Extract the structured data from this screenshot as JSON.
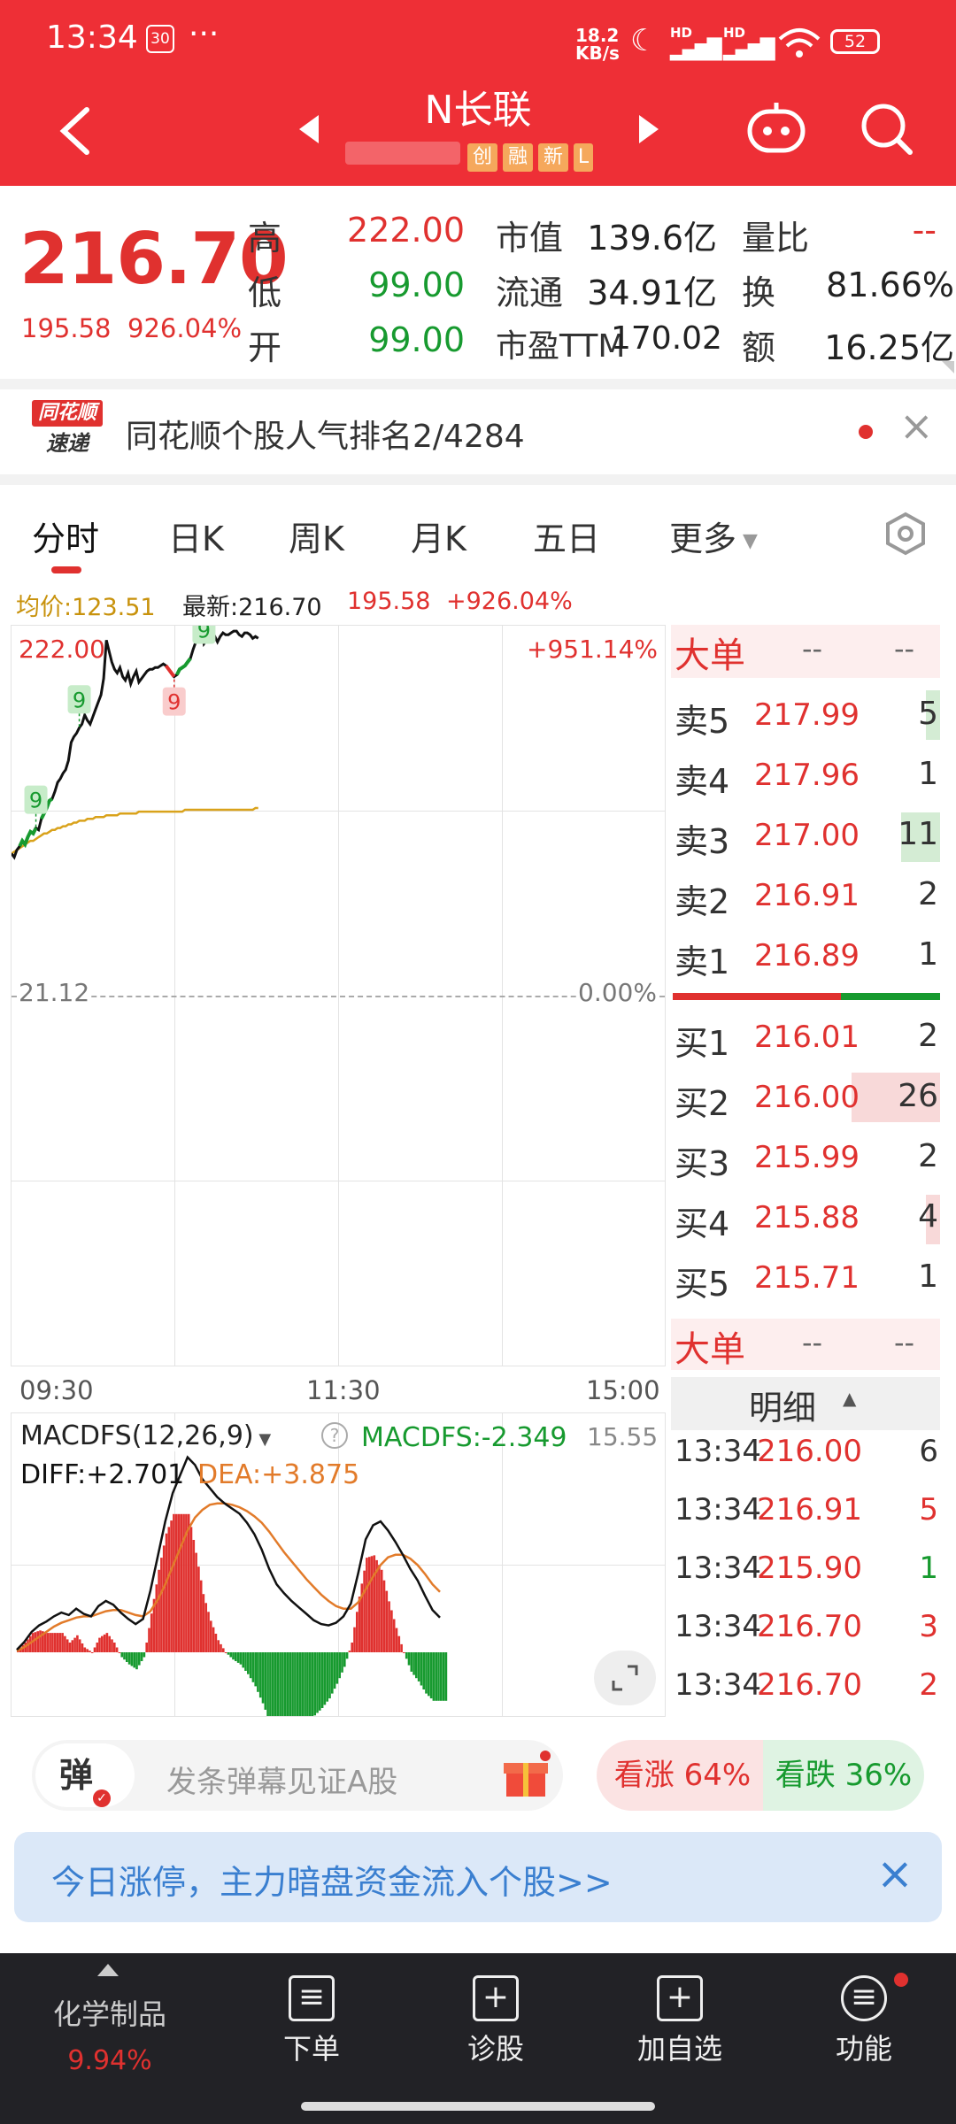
{
  "status_bar": {
    "time": "13:34",
    "badge": "30",
    "dots": "···",
    "net_speed_value": "18.2",
    "net_speed_unit": "KB/s",
    "signal1": "HD",
    "signal2": "HD",
    "battery": "52"
  },
  "header": {
    "stock_name": "N长联",
    "tags": [
      "创",
      "融",
      "新",
      "L"
    ]
  },
  "quote": {
    "price": "216.70",
    "change": "195.58",
    "change_pct": "926.04%",
    "high_label": "高",
    "high": "222.00",
    "low_label": "低",
    "low": "99.00",
    "open_label": "开",
    "open": "99.00",
    "mcap_label": "市值",
    "mcap": "139.6亿",
    "float_label": "流通",
    "float": "34.91亿",
    "pe_label": "市盈TTM",
    "pe": "170.02",
    "vol_ratio_label": "量比",
    "vol_ratio": "--",
    "turnover_label": "换",
    "turnover": "81.66%",
    "amount_label": "额",
    "amount": "16.25亿"
  },
  "news": {
    "logo_top": "同花顺",
    "logo_bottom": "速递",
    "text": "同花顺个股人气排名2/4284",
    "close": "×"
  },
  "tabs": {
    "items": [
      "分时",
      "日K",
      "周K",
      "月K",
      "五日",
      "更多"
    ],
    "active_index": 0
  },
  "chart_info": {
    "avg_label": "均价:123.51",
    "latest_label": "最新:216.70",
    "change": "195.58",
    "change_pct": "+926.04%"
  },
  "chart_data": {
    "type": "line",
    "title": "",
    "y_top": "222.00",
    "y_top_pct": "+951.14%",
    "y_mid": "21.12",
    "y_mid_pct": "0.00%",
    "x_ticks": [
      "09:30",
      "11:30",
      "15:00"
    ],
    "signals": [
      "9",
      "9",
      "9",
      "9"
    ],
    "series": [
      {
        "name": "价格",
        "values": [
          99,
          97,
          101,
          103,
          106,
          104,
          108,
          111,
          110,
          113,
          112,
          118,
          121,
          124,
          128,
          129,
          133,
          138,
          140,
          143,
          145,
          150,
          160,
          163,
          165,
          168,
          170,
          175,
          172,
          170,
          174,
          178,
          182,
          186,
          195,
          216,
          210,
          204,
          200,
          198,
          201,
          196,
          194,
          198,
          192,
          196,
          199,
          193,
          195,
          197,
          199,
          200,
          200,
          201,
          201,
          202,
          203,
          202,
          200,
          198,
          196,
          197,
          200,
          201,
          202,
          204,
          206,
          211,
          215,
          218,
          222,
          214,
          216,
          219,
          221,
          218,
          215,
          218,
          220,
          219,
          219,
          220,
          221,
          221,
          219,
          218,
          220,
          220,
          219,
          217,
          218,
          217
        ]
      },
      {
        "name": "均价",
        "values": [
          99,
          100,
          101,
          102,
          103,
          104,
          105,
          106,
          106,
          107,
          108,
          109,
          110,
          110,
          111,
          112,
          112,
          113,
          113,
          114,
          114,
          115,
          115,
          116,
          116,
          117,
          117,
          117,
          118,
          118,
          118,
          119,
          119,
          119,
          119,
          120,
          120,
          120,
          120,
          120,
          121,
          121,
          121,
          121,
          121,
          121,
          121,
          122,
          122,
          122,
          122,
          122,
          122,
          122,
          122,
          122,
          122,
          122,
          122,
          122,
          122,
          122,
          122,
          122,
          123,
          123,
          123,
          123,
          123,
          123,
          123,
          123,
          123,
          123,
          123,
          123,
          123,
          123,
          123,
          123,
          123,
          123,
          123,
          123,
          123,
          123,
          123,
          123,
          123,
          123,
          124,
          124
        ]
      }
    ]
  },
  "macd": {
    "title": "MACDFS(12,26,9)",
    "value_label": "MACDFS:-2.349",
    "top_value": "15.55",
    "diff_label": "DIFF:+2.701",
    "dea_label": "DEA:+3.875",
    "diff": [
      0.2,
      0.8,
      1.6,
      2.1,
      2.4,
      2.8,
      3.1,
      2.9,
      3.4,
      3.0,
      2.8,
      3.6,
      4.0,
      3.7,
      3.1,
      2.6,
      2.2,
      2.6,
      4.8,
      7.5,
      10.2,
      12.4,
      13.8,
      15.2,
      14.6,
      13.5,
      12.8,
      12.1,
      11.6,
      11.2,
      10.8,
      10.1,
      9.2,
      8.0,
      6.5,
      5.3,
      4.6,
      4.0,
      3.5,
      3.0,
      2.5,
      2.2,
      2.1,
      2.3,
      2.8,
      3.8,
      6.2,
      8.8,
      9.9,
      10.2,
      9.5,
      8.6,
      7.6,
      6.5,
      5.6,
      4.4,
      3.3,
      2.7
    ],
    "dea": [
      0.1,
      0.4,
      0.8,
      1.2,
      1.6,
      2.0,
      2.3,
      2.5,
      2.7,
      2.8,
      2.8,
      3.0,
      3.2,
      3.3,
      3.3,
      3.1,
      2.9,
      2.8,
      3.2,
      4.1,
      5.3,
      6.7,
      8.1,
      9.5,
      10.5,
      11.1,
      11.5,
      11.6,
      11.6,
      11.5,
      11.3,
      11.0,
      10.6,
      10.1,
      9.4,
      8.6,
      7.8,
      7.1,
      6.4,
      5.7,
      5.1,
      4.5,
      4.0,
      3.6,
      3.4,
      3.4,
      3.9,
      4.9,
      5.9,
      6.8,
      7.4,
      7.6,
      7.6,
      7.3,
      6.8,
      6.1,
      5.3,
      4.7
    ]
  },
  "orderbook": {
    "header_label": "大单",
    "header_v1": "--",
    "header_v2": "--",
    "asks": [
      {
        "label": "卖5",
        "price": "217.99",
        "vol": "5"
      },
      {
        "label": "卖4",
        "price": "217.96",
        "vol": "1"
      },
      {
        "label": "卖3",
        "price": "217.00",
        "vol": "11"
      },
      {
        "label": "卖2",
        "price": "216.91",
        "vol": "2"
      },
      {
        "label": "卖1",
        "price": "216.89",
        "vol": "1"
      }
    ],
    "bids": [
      {
        "label": "买1",
        "price": "216.01",
        "vol": "2"
      },
      {
        "label": "买2",
        "price": "216.00",
        "vol": "26"
      },
      {
        "label": "买3",
        "price": "215.99",
        "vol": "2"
      },
      {
        "label": "买4",
        "price": "215.88",
        "vol": "4"
      },
      {
        "label": "买5",
        "price": "215.71",
        "vol": "1"
      }
    ],
    "footer_label": "大单",
    "footer_v1": "--",
    "footer_v2": "--",
    "detail_label": "明细"
  },
  "ticks": [
    {
      "time": "13:34",
      "price": "216.00",
      "vol": "6",
      "dir": "sell"
    },
    {
      "time": "13:34",
      "price": "216.91",
      "vol": "5",
      "dir": "buy"
    },
    {
      "time": "13:34",
      "price": "215.90",
      "vol": "1",
      "dir": "sell"
    },
    {
      "time": "13:34",
      "price": "216.70",
      "vol": "3",
      "dir": "buy"
    },
    {
      "time": "13:34",
      "price": "216.70",
      "vol": "2",
      "dir": "buy"
    }
  ],
  "barrage": {
    "icon_label": "弹",
    "placeholder": "发条弹幕见证A股",
    "bull": "看涨 64%",
    "bear": "看跌 36%"
  },
  "banner": {
    "text": "今日涨停，主力暗盘资金流入个股>>",
    "close": "×"
  },
  "bottom_nav": {
    "sector_name": "化学制品",
    "sector_pct": "9.94%",
    "items": [
      {
        "label": "下单",
        "icon": "order-icon"
      },
      {
        "label": "诊股",
        "icon": "diagnose-icon"
      },
      {
        "label": "加自选",
        "icon": "add-watchlist-icon"
      },
      {
        "label": "功能",
        "icon": "menu-icon"
      }
    ]
  },
  "colors": {
    "header": "#ee2f36",
    "up": "#e0312f",
    "down": "#179a2f",
    "avg": "#d9a21b",
    "macd_dea": "#e27b2a"
  }
}
